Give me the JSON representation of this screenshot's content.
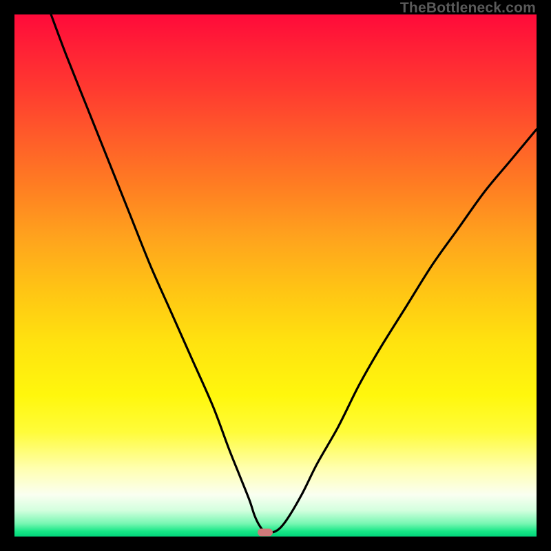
{
  "watermark": {
    "text": "TheBottleneck.com"
  },
  "chart_data": {
    "type": "line",
    "title": "",
    "xlabel": "",
    "ylabel": "",
    "xlim": [
      0,
      100
    ],
    "ylim": [
      0,
      100
    ],
    "grid": false,
    "legend": false,
    "background": "red-yellow-green vertical gradient",
    "marker": {
      "x": 48,
      "y": 0.8,
      "color": "#cf7a7a"
    },
    "series": [
      {
        "name": "curve",
        "color": "#000000",
        "x": [
          7,
          10,
          14,
          18,
          22,
          26,
          30,
          34,
          38,
          41,
          43,
          45,
          46,
          47,
          48,
          50,
          52,
          55,
          58,
          62,
          66,
          70,
          75,
          80,
          85,
          90,
          95,
          100
        ],
        "y": [
          100,
          92,
          82,
          72,
          62,
          52,
          43,
          34,
          25,
          17,
          12,
          7,
          4,
          2,
          1,
          1,
          3,
          8,
          14,
          21,
          29,
          36,
          44,
          52,
          59,
          66,
          72,
          78
        ]
      }
    ]
  }
}
